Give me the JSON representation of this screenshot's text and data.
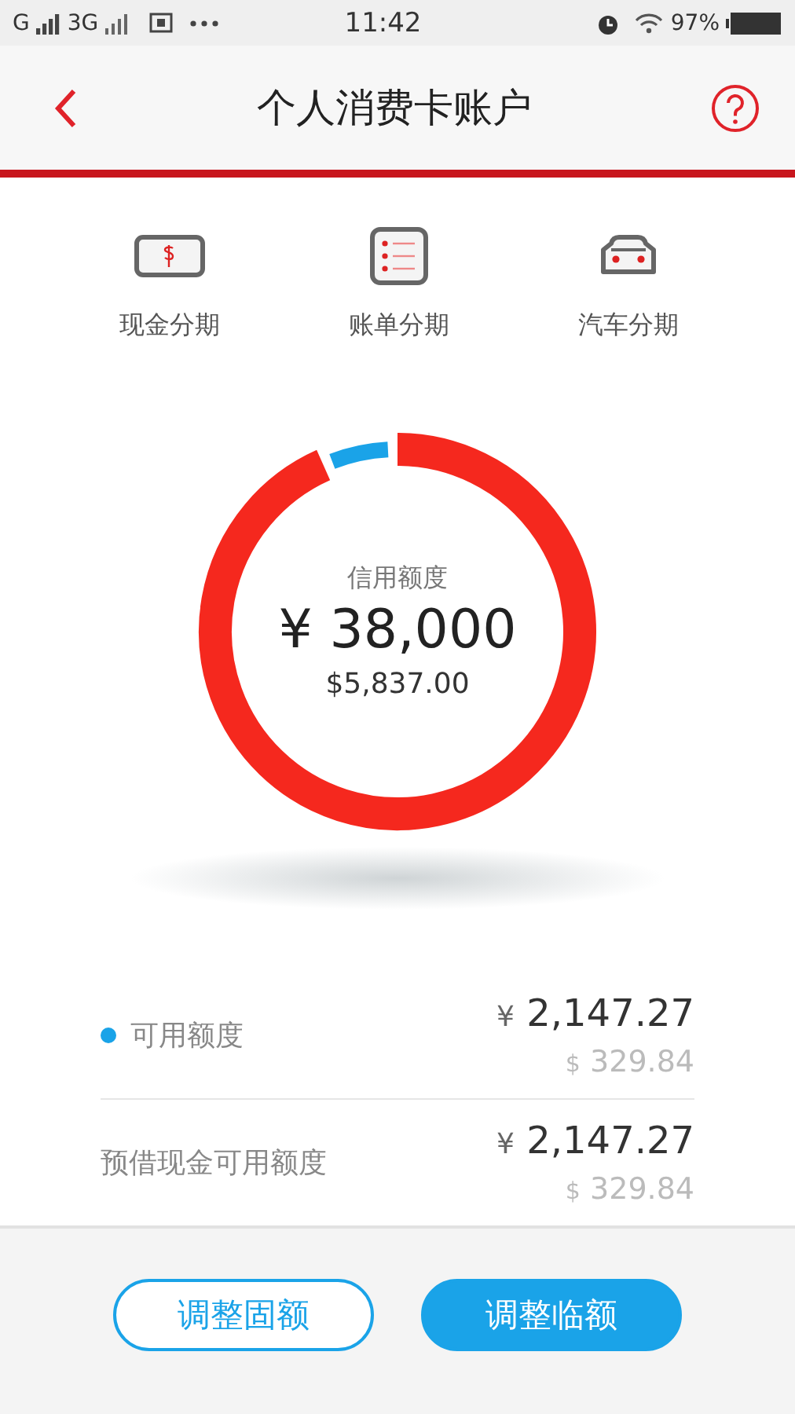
{
  "status_bar": {
    "network_1": "G",
    "network_2": "3G",
    "time": "11:42",
    "battery": "97%"
  },
  "header": {
    "title": "个人消费卡账户"
  },
  "shortcuts": [
    {
      "kind": "cash",
      "label": "现金分期"
    },
    {
      "kind": "bill",
      "label": "账单分期"
    },
    {
      "kind": "car",
      "label": "汽车分期"
    }
  ],
  "credit": {
    "label": "信用额度",
    "currency": "¥",
    "amount": "38,000",
    "usd_symbol": "$",
    "usd_amount": "5,837.00"
  },
  "rows": [
    {
      "label": "可用额度",
      "color": "#1aa3e8",
      "cny_symbol": "¥",
      "cny": "2,147.27",
      "usd_symbol": "$",
      "usd": "329.84"
    },
    {
      "label": "预借现金可用额度",
      "cny_symbol": "¥",
      "cny": "2,147.27",
      "usd_symbol": "$",
      "usd": "329.84"
    }
  ],
  "buttons": [
    {
      "label": "调整固额",
      "kind": "outline"
    },
    {
      "label": "调整临额",
      "kind": "filled"
    }
  ]
}
